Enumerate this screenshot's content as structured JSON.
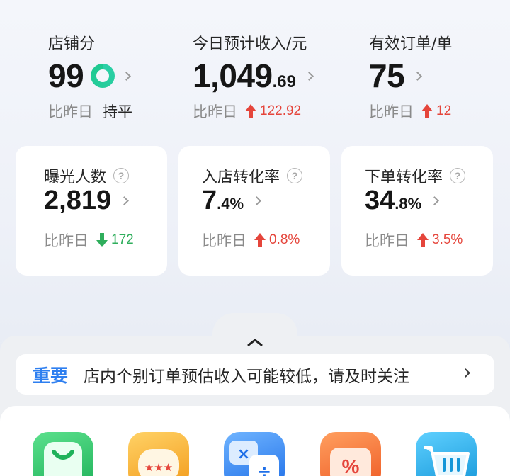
{
  "top_stats": [
    {
      "label": "店铺分",
      "value_main": "99",
      "value_dec": "",
      "compare_label": "比昨日",
      "compare_value": "持平",
      "trend": "flat"
    },
    {
      "label": "今日预计收入/元",
      "value_main": "1,049",
      "value_dec": ".69",
      "compare_label": "比昨日",
      "compare_value": "122.92",
      "trend": "up"
    },
    {
      "label": "有效订单/单",
      "value_main": "75",
      "value_dec": "",
      "compare_label": "比昨日",
      "compare_value": "12",
      "trend": "up"
    }
  ],
  "cards": [
    {
      "label": "曝光人数",
      "value_main": "2,819",
      "value_dec": "",
      "compare_label": "比昨日",
      "compare_value": "172",
      "trend": "down"
    },
    {
      "label": "入店转化率",
      "value_main": "7",
      "value_dec": ".4%",
      "compare_label": "比昨日",
      "compare_value": "0.8%",
      "trend": "up"
    },
    {
      "label": "下单转化率",
      "value_main": "34",
      "value_dec": ".8%",
      "compare_label": "比昨日",
      "compare_value": "3.5%",
      "trend": "up"
    }
  ],
  "notice": {
    "tag": "重要",
    "message": "店内个别订单预估收入可能较低，请及时关注"
  },
  "colors": {
    "up": "#e5453b",
    "down": "#2fae5c",
    "accent": "#2e7ff0"
  },
  "apps": [
    {
      "icon": "shopping-bag-icon",
      "color": "#2ec46a"
    },
    {
      "icon": "review-bubble-icon",
      "color": "#f5a623"
    },
    {
      "icon": "calculator-icon",
      "color": "#2f86f0"
    },
    {
      "icon": "coupon-percent-icon",
      "color": "#f2763a"
    },
    {
      "icon": "shopping-cart-icon",
      "color": "#22a9e6"
    }
  ]
}
